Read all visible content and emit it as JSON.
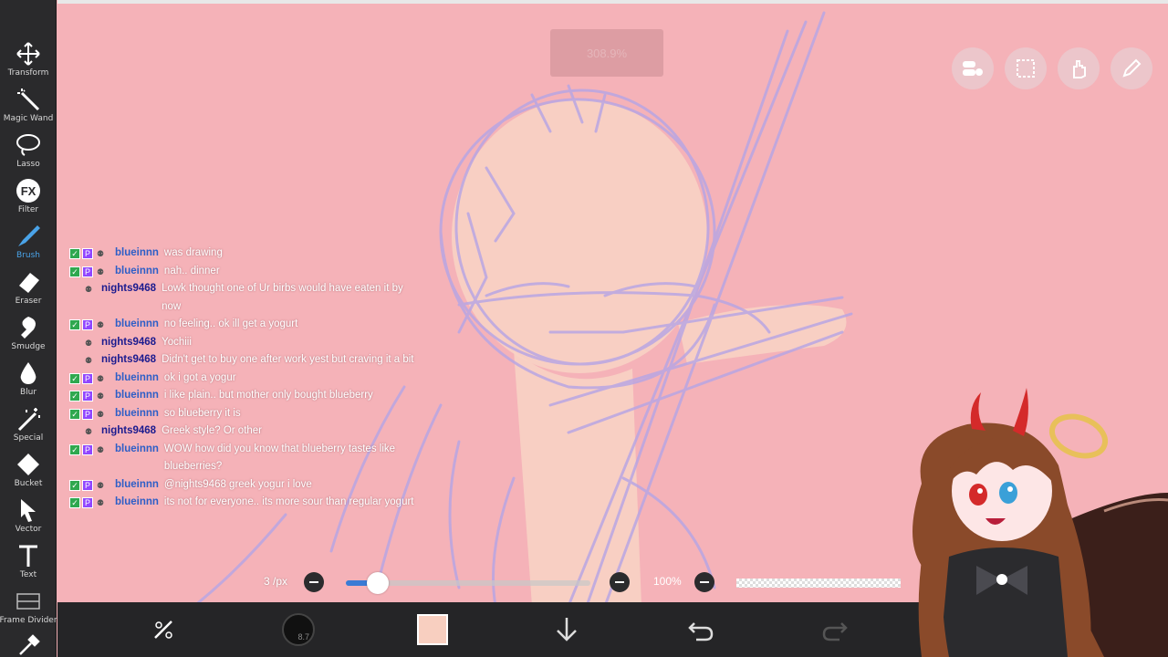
{
  "toolbar": {
    "tools": [
      {
        "label": "Transform",
        "icon": "move-icon"
      },
      {
        "label": "Magic Wand",
        "icon": "magic-wand-icon"
      },
      {
        "label": "Lasso",
        "icon": "lasso-icon"
      },
      {
        "label": "Filter",
        "icon": "fx-icon"
      },
      {
        "label": "Brush",
        "icon": "brush-icon"
      },
      {
        "label": "Eraser",
        "icon": "eraser-icon"
      },
      {
        "label": "Smudge",
        "icon": "smudge-icon"
      },
      {
        "label": "Blur",
        "icon": "blur-drop-icon"
      },
      {
        "label": "Special",
        "icon": "special-wand-icon"
      },
      {
        "label": "Bucket",
        "icon": "bucket-icon"
      },
      {
        "label": "Vector",
        "icon": "vector-cursor-icon"
      },
      {
        "label": "Text",
        "icon": "text-icon"
      },
      {
        "label": "Frame Divider",
        "icon": "frame-divider-icon"
      }
    ]
  },
  "canvas": {
    "zoom": "308.9%"
  },
  "top_buttons": [
    "toggle-icon",
    "selection-icon",
    "hand-icon",
    "pencil-icon"
  ],
  "chat": [
    {
      "user": "blueinnn",
      "color": "blue",
      "badges": true,
      "text": "was drawing"
    },
    {
      "user": "blueinnn",
      "color": "blue",
      "badges": true,
      "text": "nah.. dinner"
    },
    {
      "user": "nights9468",
      "color": "navy",
      "badges": false,
      "text": "Lowk thought one of Ur birbs would have eaten it by now"
    },
    {
      "user": "blueinnn",
      "color": "blue",
      "badges": true,
      "text": "no feeling.. ok ill get a yogurt"
    },
    {
      "user": "nights9468",
      "color": "navy",
      "badges": false,
      "text": "Yochiii"
    },
    {
      "user": "nights9468",
      "color": "navy",
      "badges": false,
      "text": "Didn't get to buy one after work yest but craving it a bit"
    },
    {
      "user": "blueinnn",
      "color": "blue",
      "badges": true,
      "text": "ok i got a yogur"
    },
    {
      "user": "blueinnn",
      "color": "blue",
      "badges": true,
      "text": "i like plain.. but mother only bought blueberry"
    },
    {
      "user": "blueinnn",
      "color": "blue",
      "badges": true,
      "text": "so blueberry it is"
    },
    {
      "user": "nights9468",
      "color": "navy",
      "badges": false,
      "text": "Greek style? Or other"
    },
    {
      "user": "blueinnn",
      "color": "blue",
      "badges": true,
      "text": "WOW how did you know that blueberry tastes like blueberries?"
    },
    {
      "user": "blueinnn",
      "color": "blue",
      "badges": true,
      "text": "@nights9468 greek yogur i love"
    },
    {
      "user": "blueinnn",
      "color": "blue",
      "badges": true,
      "text": "its not for everyone.. its more sour than regular yogurt"
    }
  ],
  "brush": {
    "size_label": "3 /px",
    "size_fraction": 0.13,
    "opacity_label": "100%"
  },
  "bottombar": {
    "brush_size_value": "8.7",
    "color_hex": "#f8cfc0"
  },
  "colors": {
    "canvas": "#f5b2b8",
    "sketch": "#b9a6e3",
    "toolbar": "#2a2a2c",
    "accent": "#3a7bd5"
  }
}
